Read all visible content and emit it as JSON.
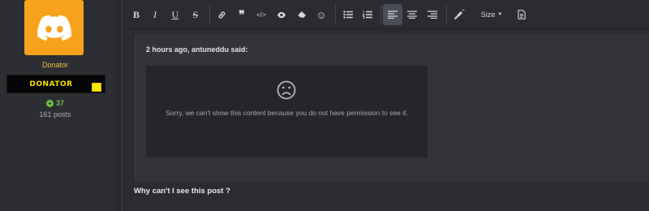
{
  "user": {
    "title": "Donator",
    "banner": "DONATOR",
    "reaction_score": "37",
    "posts": "161 posts",
    "avatar_icon": "discord-logo",
    "colors": {
      "avatar_bg": "#f7a21b",
      "title": "#f0c23a",
      "reaction": "#6fbf46"
    }
  },
  "toolbar": {
    "buttons": [
      {
        "name": "bold",
        "glyph": "B"
      },
      {
        "name": "italic",
        "glyph": "I"
      },
      {
        "name": "underline",
        "glyph": "U"
      },
      {
        "name": "strikethrough",
        "glyph": "S"
      },
      {
        "name": "link",
        "glyph": "🔗"
      },
      {
        "name": "quote",
        "glyph": "❞"
      },
      {
        "name": "code",
        "glyph": "</>"
      },
      {
        "name": "spoiler",
        "glyph": "👁"
      },
      {
        "name": "remove-format",
        "glyph": "⌫"
      },
      {
        "name": "smilies",
        "glyph": "☺"
      },
      {
        "name": "bullet-list",
        "glyph": "≡"
      },
      {
        "name": "numbered-list",
        "glyph": "≡"
      },
      {
        "name": "align-left",
        "glyph": "≡"
      },
      {
        "name": "align-center",
        "glyph": "≡"
      },
      {
        "name": "align-right",
        "glyph": "≡"
      },
      {
        "name": "text-color",
        "glyph": "🖌"
      },
      {
        "name": "drafts",
        "glyph": "🗎"
      }
    ],
    "size_label": "Size"
  },
  "quote": {
    "header": "2 hours ago, antuneddu said:",
    "locked_message": "Sorry, we can't show this content because you do not have permission to see it."
  },
  "reply": {
    "text": "Why can't I see this post ?"
  }
}
